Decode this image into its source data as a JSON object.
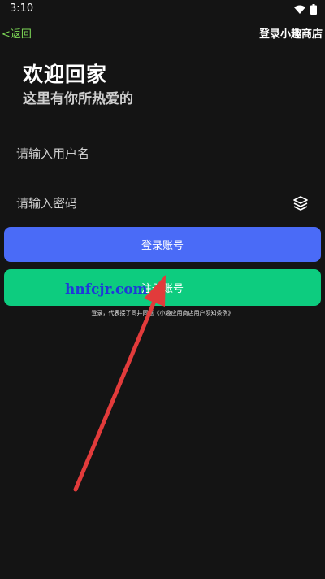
{
  "status": {
    "time": "3:10"
  },
  "top_bar": {
    "back": "<返回",
    "title": "登录小趣商店"
  },
  "welcome": {
    "title": "欢迎回家",
    "subtitle": "这里有你所热爱的"
  },
  "form": {
    "username_placeholder": "请输入用户名",
    "password_placeholder": "请输入密码",
    "login_button": "登录账号",
    "register_button": "注册账号",
    "agreement": "登录，代表接了同并同意《小趣应用商店用户须知条例》"
  },
  "watermark": "hnfcjr.com",
  "colors": {
    "background": "#141414",
    "login": "#4a6bf7",
    "register": "#0dcc7f",
    "back": "#7ed957",
    "arrow": "#e23b3b"
  }
}
